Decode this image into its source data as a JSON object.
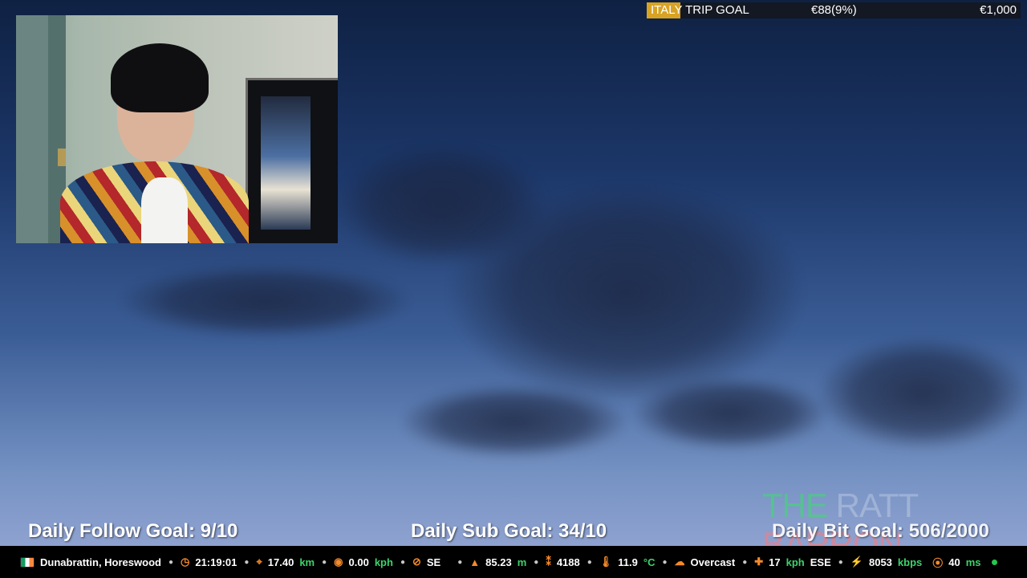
{
  "goal": {
    "title": "ITALY TRIP GOAL",
    "current": "€88(9%)",
    "target": "€1,000",
    "progress_percent": 9,
    "colors": {
      "fill": "#d8a323",
      "background": "#141822"
    }
  },
  "bottom_goals": {
    "follow": "Daily Follow Goal: 9/10",
    "sub": "Daily Sub Goal: 34/10",
    "bit": "Daily Bit Goal: 506/2000"
  },
  "watermark": {
    "prefix": "THE",
    "middle": "RATT",
    "suffix": "BARRON"
  },
  "status": {
    "location": "Dunabrattin, Horeswood",
    "time": "21:19:01",
    "distance_value": "17.40",
    "distance_unit": "km",
    "speed_value": "0.00",
    "speed_unit": "kph",
    "heading": "SE",
    "altitude_value": "85.23",
    "altitude_unit": "m",
    "steps": "4188",
    "temperature_value": "11.9",
    "temperature_unit": "°C",
    "weather": "Overcast",
    "wind_value": "17",
    "wind_unit": "kph",
    "wind_direction": "ESE",
    "bitrate_value": "8053",
    "bitrate_unit": "kbps",
    "latency_value": "40",
    "latency_unit": "ms"
  },
  "icons": {
    "flag": "ireland-flag-icon",
    "clock": "clock-icon",
    "location": "map-pin-icon",
    "speed": "speed-icon",
    "compass": "compass-icon",
    "altitude": "mountain-icon",
    "steps": "footprints-icon",
    "thermometer": "thermometer-icon",
    "weather": "cloud-icon",
    "wind": "wind-icon",
    "bolt": "lightning-icon",
    "satellite": "satellite-icon",
    "online": "status-dot-icon"
  },
  "colors": {
    "accent": "#f58a2b",
    "unit": "#3cd36b",
    "status_ok": "#26c74e"
  }
}
